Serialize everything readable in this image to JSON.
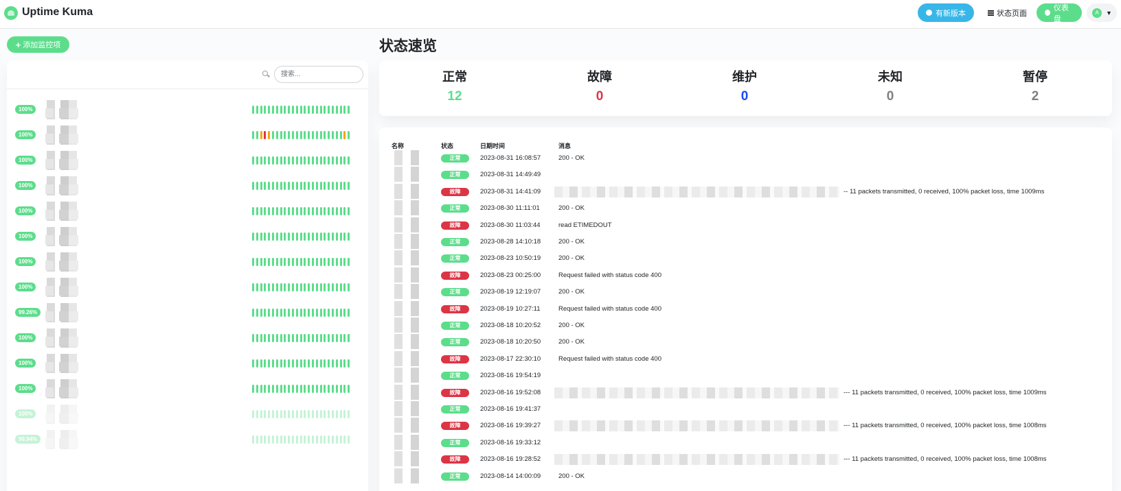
{
  "header": {
    "brand": "Uptime Kuma",
    "update_label": "有新版本",
    "status_page_label": "状态页面",
    "dashboard_label": "仪表盘",
    "avatar_letter": "A"
  },
  "add_monitor_label": "添加监控项",
  "search": {
    "placeholder": "搜索..."
  },
  "monitors": [
    {
      "uptime": "100%",
      "paused": false
    },
    {
      "uptime": "100%",
      "paused": false
    },
    {
      "uptime": "100%",
      "paused": false
    },
    {
      "uptime": "100%",
      "paused": false
    },
    {
      "uptime": "100%",
      "paused": false
    },
    {
      "uptime": "100%",
      "paused": false
    },
    {
      "uptime": "100%",
      "paused": false
    },
    {
      "uptime": "100%",
      "paused": false
    },
    {
      "uptime": "99.26%",
      "paused": false
    },
    {
      "uptime": "100%",
      "paused": false
    },
    {
      "uptime": "100%",
      "paused": false
    },
    {
      "uptime": "100%",
      "paused": false
    },
    {
      "uptime": "100%",
      "paused": true
    },
    {
      "uptime": "99.94%",
      "paused": true
    }
  ],
  "page_title": "状态速览",
  "stats": [
    {
      "label": "正常",
      "value": "12",
      "color": "#5cdd8b"
    },
    {
      "label": "故障",
      "value": "0",
      "color": "#dc3545"
    },
    {
      "label": "维护",
      "value": "0",
      "color": "#1747f5"
    },
    {
      "label": "未知",
      "value": "0",
      "color": "#7f7f7f"
    },
    {
      "label": "暂停",
      "value": "2",
      "color": "#7f7f7f"
    }
  ],
  "table_headers": {
    "name": "名称",
    "status": "状态",
    "datetime": "日期时间",
    "message": "消息"
  },
  "status_labels": {
    "up": "正常",
    "down": "故障"
  },
  "events": [
    {
      "status": "up",
      "time": "2023-08-31 16:08:57",
      "message": "200 - OK",
      "redacted": false
    },
    {
      "status": "up",
      "time": "2023-08-31 14:49:49",
      "message": "",
      "redacted": false
    },
    {
      "status": "down",
      "time": "2023-08-31 14:41:09",
      "message": "-- 11 packets transmitted, 0 received, 100% packet loss, time 1009ms",
      "redacted": true
    },
    {
      "status": "up",
      "time": "2023-08-30 11:11:01",
      "message": "200 - OK",
      "redacted": false
    },
    {
      "status": "down",
      "time": "2023-08-30 11:03:44",
      "message": "read ETIMEDOUT",
      "redacted": false
    },
    {
      "status": "up",
      "time": "2023-08-28 14:10:18",
      "message": "200 - OK",
      "redacted": false
    },
    {
      "status": "up",
      "time": "2023-08-23 10:50:19",
      "message": "200 - OK",
      "redacted": false
    },
    {
      "status": "down",
      "time": "2023-08-23 00:25:00",
      "message": "Request failed with status code 400",
      "redacted": false
    },
    {
      "status": "up",
      "time": "2023-08-19 12:19:07",
      "message": "200 - OK",
      "redacted": false
    },
    {
      "status": "down",
      "time": "2023-08-19 10:27:11",
      "message": "Request failed with status code 400",
      "redacted": false
    },
    {
      "status": "up",
      "time": "2023-08-18 10:20:52",
      "message": "200 - OK",
      "redacted": false
    },
    {
      "status": "up",
      "time": "2023-08-18 10:20:50",
      "message": "200 - OK",
      "redacted": false
    },
    {
      "status": "down",
      "time": "2023-08-17 22:30:10",
      "message": "Request failed with status code 400",
      "redacted": false
    },
    {
      "status": "up",
      "time": "2023-08-16 19:54:19",
      "message": "",
      "redacted": false
    },
    {
      "status": "down",
      "time": "2023-08-16 19:52:08",
      "message": "--- 11 packets transmitted, 0 received, 100% packet loss, time 1009ms",
      "redacted": true
    },
    {
      "status": "up",
      "time": "2023-08-16 19:41:37",
      "message": "",
      "redacted": false
    },
    {
      "status": "down",
      "time": "2023-08-16 19:39:27",
      "message": "--- 11 packets transmitted, 0 received, 100% packet loss, time 1008ms",
      "redacted": true
    },
    {
      "status": "up",
      "time": "2023-08-16 19:33:12",
      "message": "",
      "redacted": false
    },
    {
      "status": "down",
      "time": "2023-08-16 19:28:52",
      "message": "--- 11 packets transmitted, 0 received, 100% packet loss, time 1008ms",
      "redacted": true
    },
    {
      "status": "up",
      "time": "2023-08-14 14:00:09",
      "message": "200 - OK",
      "redacted": false
    }
  ]
}
